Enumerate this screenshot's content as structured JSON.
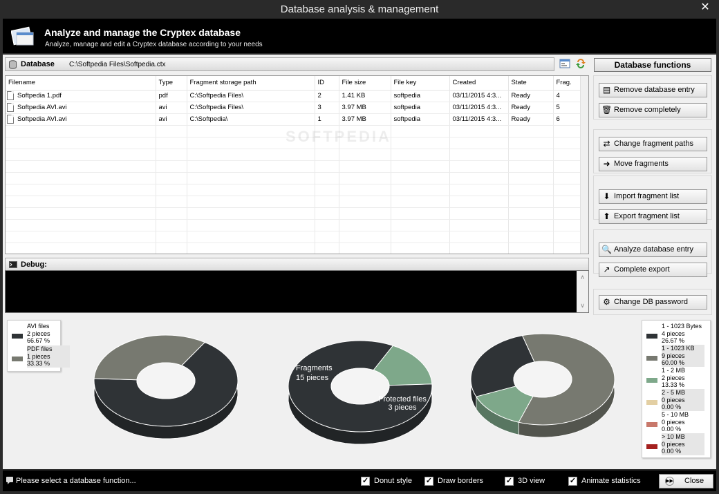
{
  "window": {
    "title": "Database analysis & management",
    "close_glyph": "✕"
  },
  "header": {
    "title": "Analyze and manage the Cryptex database",
    "subtitle": "Analyze, manage and edit a Cryptex database according to your needs"
  },
  "database": {
    "label": "Database",
    "path": "C:\\Softpedia Files\\Softpedia.ctx",
    "columns": [
      "Filename",
      "Type",
      "Fragment storage path",
      "ID",
      "File size",
      "File key",
      "Created",
      "State",
      "Frag."
    ],
    "rows": [
      [
        "Softpedia 1.pdf",
        "pdf",
        "C:\\Softpedia Files\\",
        "2",
        "1.41 KB",
        "softpedia",
        "03/11/2015 4:3...",
        "Ready",
        "4"
      ],
      [
        "Softpedia AVI.avi",
        "avi",
        "C:\\Softpedia Files\\",
        "3",
        "3.97 MB",
        "softpedia",
        "03/11/2015 4:3...",
        "Ready",
        "5"
      ],
      [
        "Softpedia AVI.avi",
        "avi",
        "C:\\Softpedia\\",
        "1",
        "3.97 MB",
        "softpedia",
        "03/11/2015 4:3...",
        "Ready",
        "6"
      ]
    ]
  },
  "debug": {
    "label": "Debug:"
  },
  "functions": {
    "title": "Database functions",
    "buttons": [
      "Remove database entry",
      "Remove completely",
      "Change fragment paths",
      "Move fragments",
      "Import fragment list",
      "Export fragment list",
      "Analyze database entry",
      "Complete export",
      "Change DB password"
    ]
  },
  "legend_types": [
    {
      "name": "AVI files",
      "pieces": "2 pieces",
      "pct": "66.67 %",
      "color": "#2f3336"
    },
    {
      "name": "PDF files",
      "pieces": "1 pieces",
      "pct": "33.33 %",
      "color": "#777970"
    }
  ],
  "legend_sizes": [
    {
      "name": "1 - 1023 Bytes",
      "pieces": "4 pieces",
      "pct": "26.67 %",
      "color": "#2f3336"
    },
    {
      "name": "1 - 1023 KB",
      "pieces": "9 pieces",
      "pct": "60.00 %",
      "color": "#777970"
    },
    {
      "name": "1 - 2 MB",
      "pieces": "2 pieces",
      "pct": "13.33 %",
      "color": "#7ea88a"
    },
    {
      "name": "2 - 5 MB",
      "pieces": "0 pieces",
      "pct": "0.00 %",
      "color": "#e3cfa3"
    },
    {
      "name": "5 - 10 MB",
      "pieces": "0 pieces",
      "pct": "0.00 %",
      "color": "#c8786b"
    },
    {
      "name": "> 10 MB",
      "pieces": "0 pieces",
      "pct": "0.00 %",
      "color": "#a4201f"
    }
  ],
  "charts": {
    "types": [
      {
        "value": 66.67,
        "color": "#2f3336"
      },
      {
        "value": 33.33,
        "color": "#777970"
      }
    ],
    "fragments": [
      {
        "value": 15,
        "color": "#2f3336",
        "label": "Fragments",
        "sub": "15 pieces"
      },
      {
        "value": 3,
        "color": "#7ea88a",
        "label": "Protected files",
        "sub": "3 pieces"
      }
    ],
    "sizes": [
      {
        "value": 26.67,
        "color": "#2f3336"
      },
      {
        "value": 60.0,
        "color": "#777970"
      },
      {
        "value": 13.33,
        "color": "#7ea88a"
      }
    ]
  },
  "statusbar": {
    "message": "Please select a database function...",
    "options": [
      {
        "label": "Donut style",
        "checked": true
      },
      {
        "label": "Draw borders",
        "checked": true
      },
      {
        "label": "3D view",
        "checked": true
      },
      {
        "label": "Animate statistics",
        "checked": true
      }
    ],
    "close_label": "Close"
  },
  "watermark": "SOFTPEDIA"
}
